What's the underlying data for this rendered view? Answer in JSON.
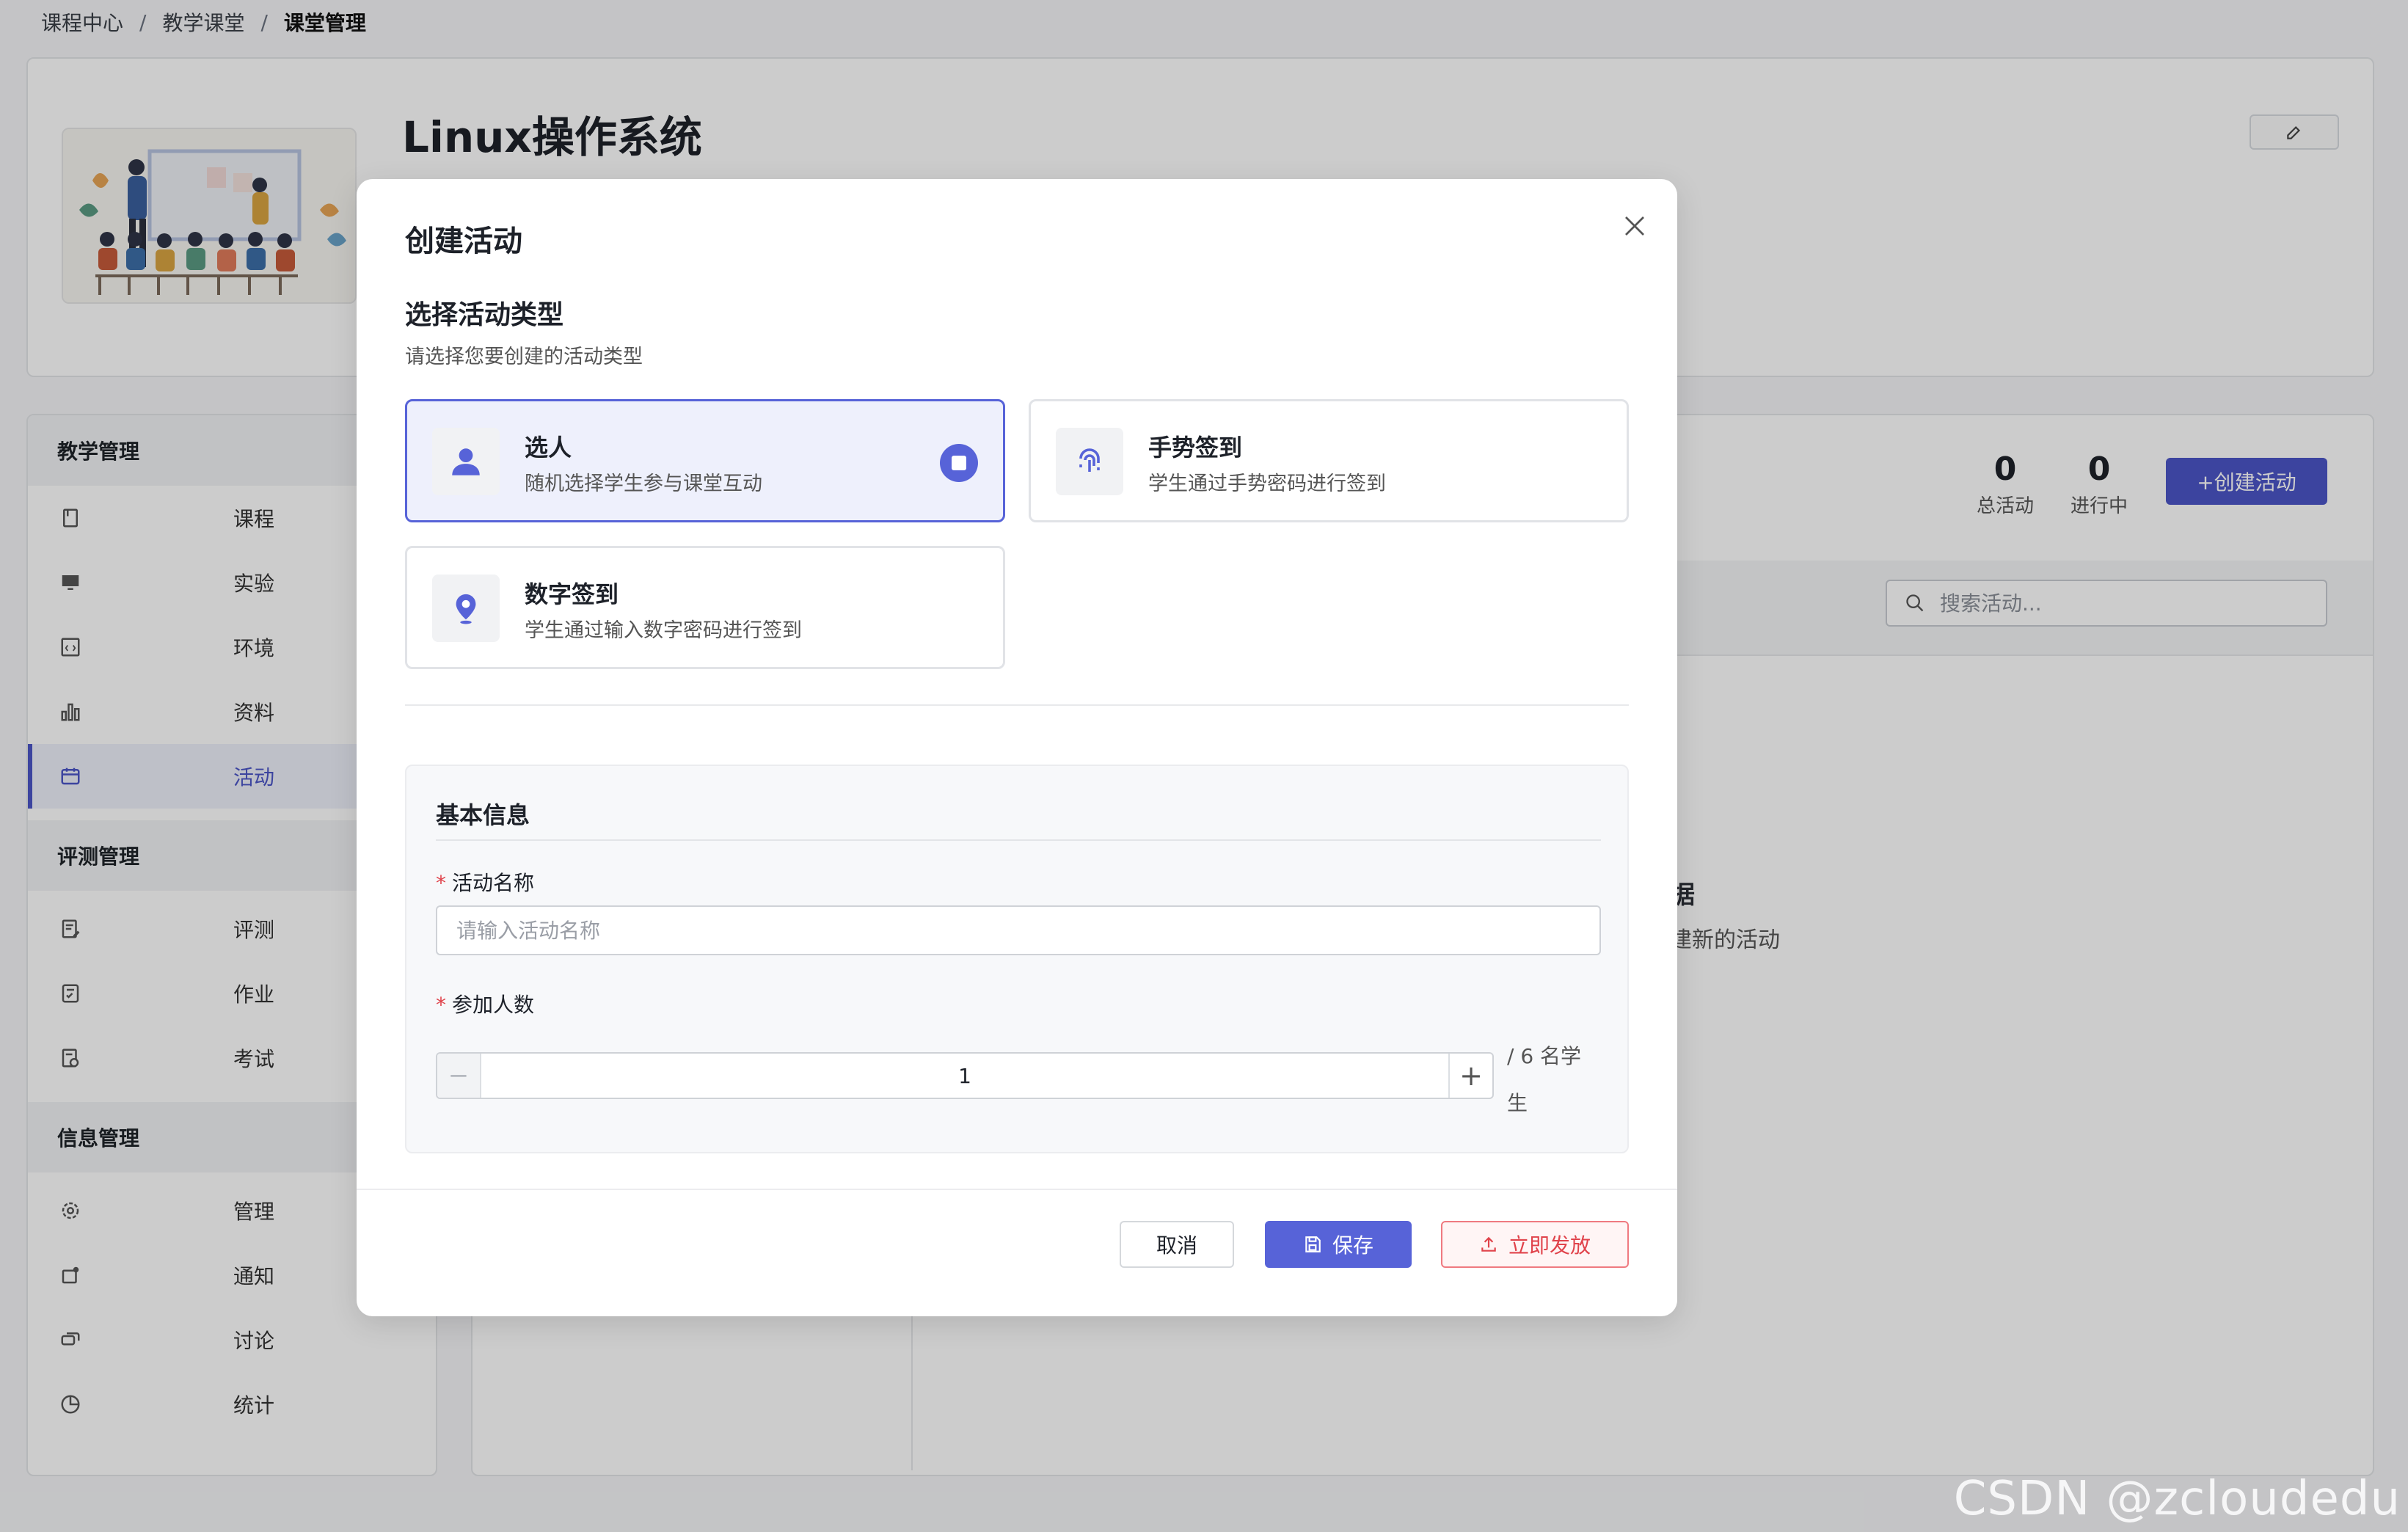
{
  "breadcrumb": {
    "items": [
      "课程中心",
      "教学课堂",
      "课堂管理"
    ],
    "separator": "/"
  },
  "course": {
    "title": "Linux操作系统"
  },
  "sidebar": {
    "groups": [
      {
        "title": "教学管理",
        "items": [
          "课程",
          "实验",
          "环境",
          "资料",
          "活动"
        ]
      },
      {
        "title": "评测管理",
        "items": [
          "评测",
          "作业",
          "考试"
        ]
      },
      {
        "title": "信息管理",
        "items": [
          "管理",
          "通知",
          "讨论",
          "统计"
        ]
      }
    ],
    "active": "活动"
  },
  "stats": {
    "total_value": "0",
    "total_label": "总活动",
    "ongoing_value": "0",
    "ongoing_label": "进行中"
  },
  "create_button": "+创建活动",
  "search": {
    "placeholder": "搜索活动..."
  },
  "empty_state": {
    "title": "据",
    "subtitle": "建新的活动"
  },
  "watermark": "CSDN @zcloudedu",
  "modal": {
    "title": "创建活动",
    "section_title": "选择活动类型",
    "section_subtitle": "请选择您要创建的活动类型",
    "types": [
      {
        "name": "选人",
        "desc": "随机选择学生参与课堂互动",
        "icon": "user-icon",
        "selected": true
      },
      {
        "name": "手势签到",
        "desc": "学生通过手势密码进行签到",
        "icon": "fingerprint-icon",
        "selected": false
      },
      {
        "name": "数字签到",
        "desc": "学生通过输入数字密码进行签到",
        "icon": "location-pin-icon",
        "selected": false
      }
    ],
    "basic_info": {
      "title": "基本信息",
      "name_label": "活动名称",
      "name_placeholder": "请输入活动名称",
      "name_value": "",
      "count_label": "参加人数",
      "count_value": "1",
      "count_total": "/ 6 名学生"
    },
    "buttons": {
      "cancel": "取消",
      "save": "保存",
      "publish": "立即发放"
    }
  },
  "colors": {
    "accent": "#5763d8",
    "primary_button": "#4b55c7",
    "danger": "#e0434b",
    "required": "#e0434b"
  }
}
